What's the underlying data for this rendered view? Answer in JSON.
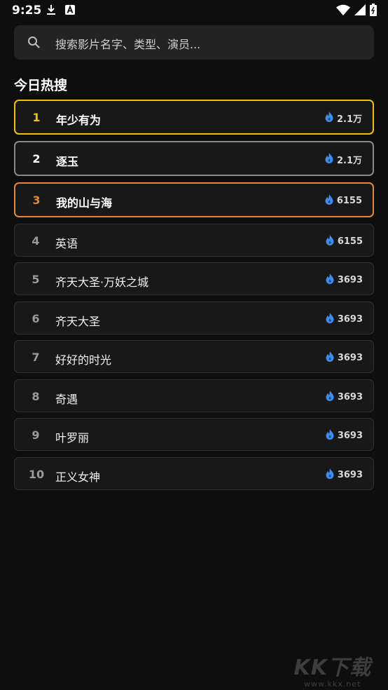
{
  "status_bar": {
    "time": "9:25",
    "left_icons": [
      "download-icon",
      "a-badge-icon"
    ],
    "right_icons": [
      "wifi-icon",
      "signal-icon",
      "battery-icon"
    ]
  },
  "search": {
    "placeholder": "搜索影片名字、类型、演员..."
  },
  "section": {
    "title": "今日热搜"
  },
  "colors": {
    "rank1": "#f2c200",
    "rank2": "#ffffff",
    "rank3": "#e08a2e",
    "hot_icon": "#3d8ef0",
    "background": "#0e0e0e",
    "card": "#181818"
  },
  "hot_list": [
    {
      "rank": "1",
      "title": "年少有为",
      "heat": "2.1万"
    },
    {
      "rank": "2",
      "title": "逐玉",
      "heat": "2.1万"
    },
    {
      "rank": "3",
      "title": "我的山与海",
      "heat": "6155"
    },
    {
      "rank": "4",
      "title": "英语",
      "heat": "6155"
    },
    {
      "rank": "5",
      "title": "齐天大圣·万妖之城",
      "heat": "3693"
    },
    {
      "rank": "6",
      "title": "齐天大圣",
      "heat": "3693"
    },
    {
      "rank": "7",
      "title": "好好的时光",
      "heat": "3693"
    },
    {
      "rank": "8",
      "title": "奇遇",
      "heat": "3693"
    },
    {
      "rank": "9",
      "title": "叶罗丽",
      "heat": "3693"
    },
    {
      "rank": "10",
      "title": "正义女神",
      "heat": "3693"
    }
  ],
  "watermark": {
    "logo": "KK下载",
    "url": "www.kkx.net"
  }
}
